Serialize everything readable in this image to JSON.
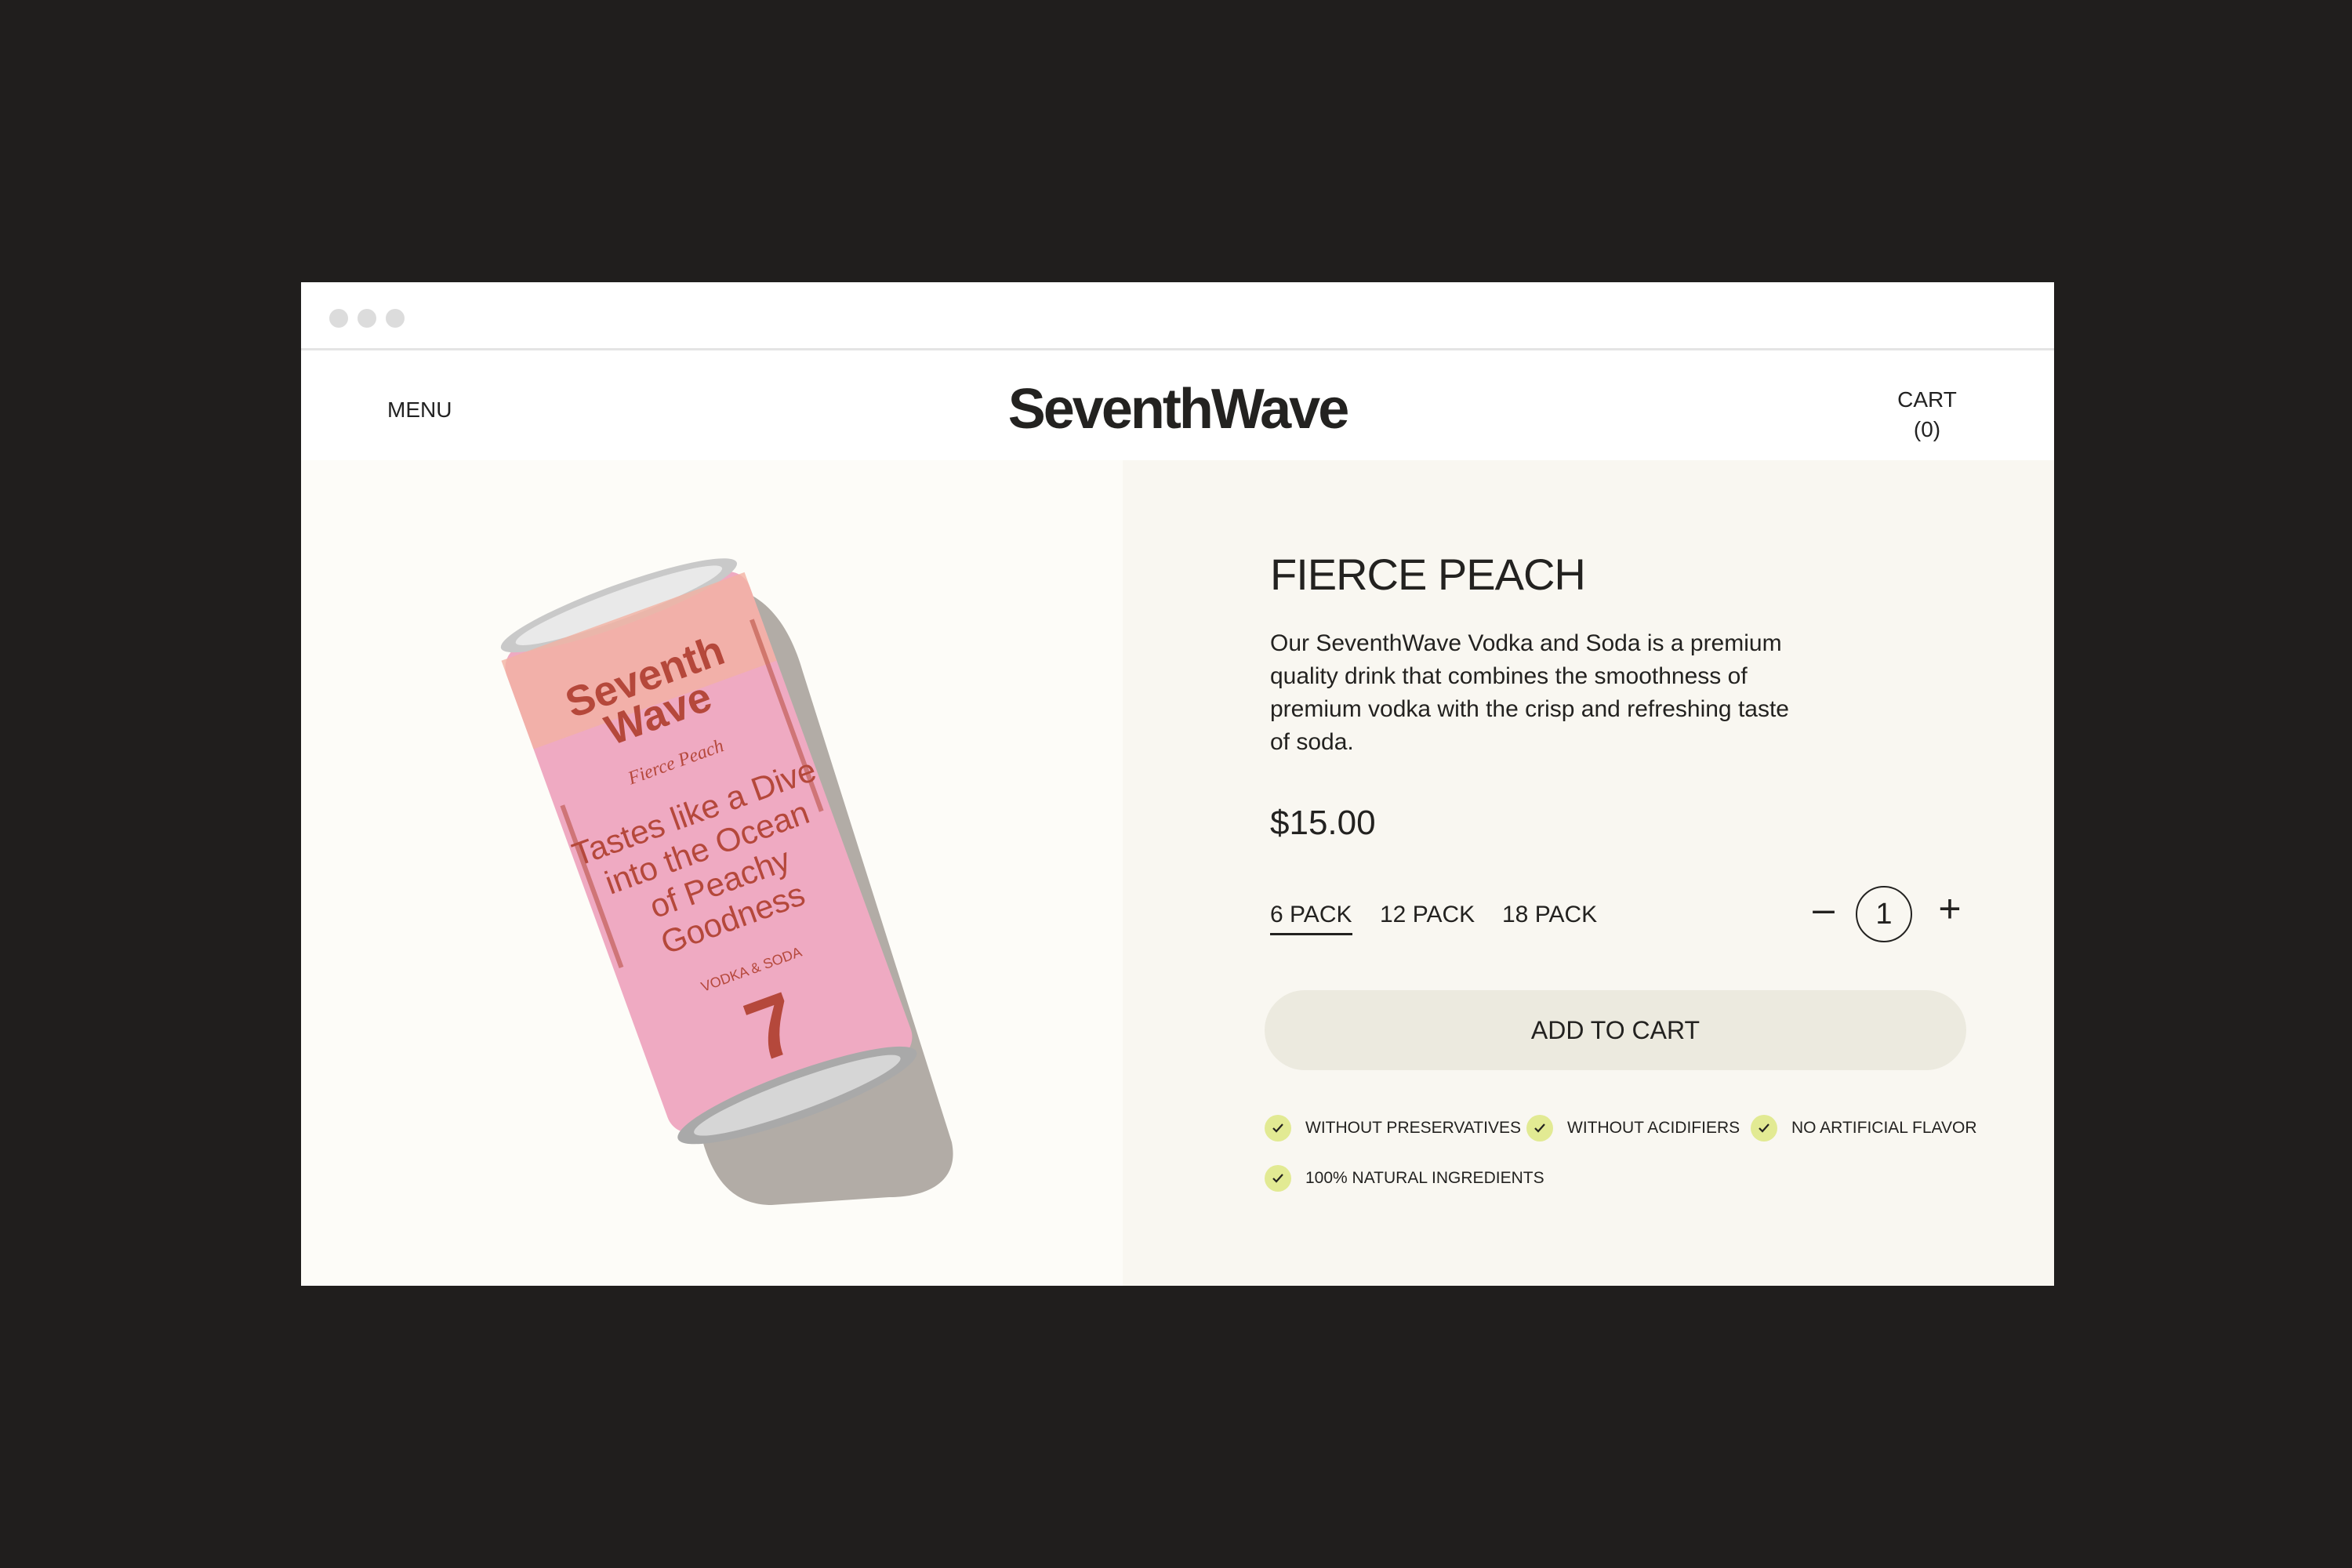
{
  "brand": {
    "name": "SeventhWave"
  },
  "header": {
    "menu_label": "MENU",
    "cart_label": "CART",
    "cart_count": "(0)"
  },
  "product": {
    "title": "FIERCE PEACH",
    "description": "Our SeventhWave Vodka and Soda is a premium quality drink that combines the smoothness of premium vodka with the crisp and refreshing taste of soda.",
    "price": "$15.00",
    "packs": [
      "6 PACK",
      "12 PACK",
      "18 PACK"
    ],
    "selected_pack": "6 PACK",
    "quantity": "1",
    "add_to_cart_label": "ADD TO CART",
    "features": [
      "WITHOUT PRESERVATIVES",
      "WITHOUT ACIDIFIERS",
      "NO ARTIFICIAL FLAVOR",
      "100% NATURAL INGREDIENTS"
    ]
  },
  "can": {
    "brand_line1": "Seventh",
    "brand_line2": "Wave",
    "flavor": "Fierce Peach",
    "tagline_1": "Tastes like a Dive",
    "tagline_2": "into the Ocean",
    "tagline_3": "of Peachy",
    "tagline_4": "Goodness",
    "type": "VODKA & SODA",
    "number": "7"
  },
  "colors": {
    "page_bg": "#201e1d",
    "accent_check": "#e2ea93",
    "can_pink": "#f0a9c2",
    "can_text": "#b5483b"
  }
}
